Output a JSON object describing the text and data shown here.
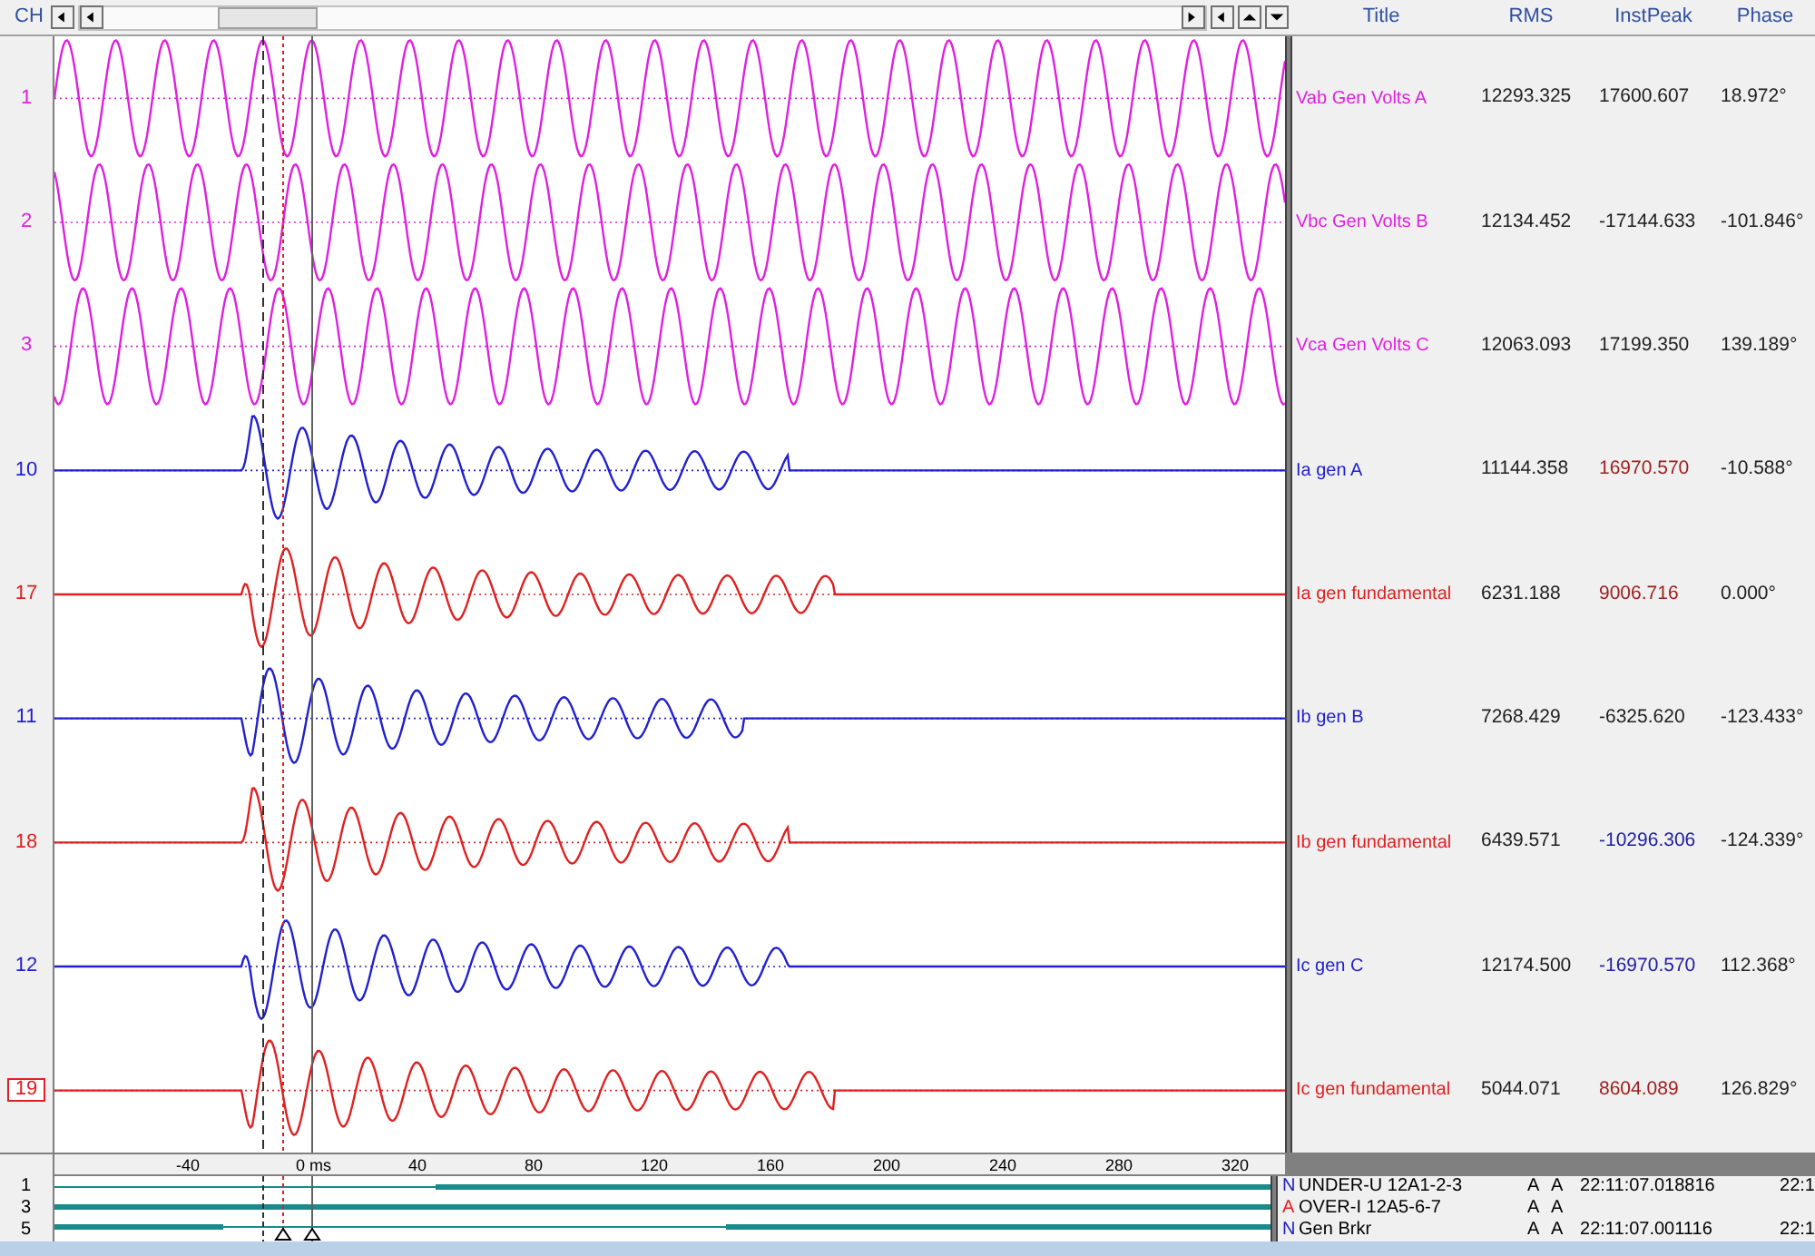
{
  "toolbar": {
    "label": "CH"
  },
  "columns": [
    "Title",
    "RMS",
    "InstPeak",
    "Phase"
  ],
  "channels": [
    {
      "number": "1",
      "title": "Vab Gen Volts A",
      "rms": "12293.325",
      "inst_peak": {
        "text": "17600.607",
        "color": "#202020"
      },
      "phase": "18.972°",
      "color": "#e020e0",
      "kind": "sine",
      "selected": false
    },
    {
      "number": "2",
      "title": "Vbc Gen Volts B",
      "rms": "12134.452",
      "inst_peak": {
        "text": "-17144.633",
        "color": "#202020"
      },
      "phase": "-101.846°",
      "color": "#e020e0",
      "kind": "sine",
      "selected": false
    },
    {
      "number": "3",
      "title": "Vca Gen Volts C",
      "rms": "12063.093",
      "inst_peak": {
        "text": "17199.350",
        "color": "#202020"
      },
      "phase": "139.189°",
      "color": "#e020e0",
      "kind": "sine",
      "selected": false
    },
    {
      "number": "10",
      "title": "Ia gen A",
      "rms": "11144.358",
      "inst_peak": {
        "text": "16970.570",
        "color": "#a02020"
      },
      "phase": "-10.588°",
      "color": "#2020d0",
      "kind": "fault",
      "selected": false
    },
    {
      "number": "17",
      "title": "Ia gen fundamental",
      "rms": "6231.188",
      "inst_peak": {
        "text": "9006.716",
        "color": "#a02020"
      },
      "phase": "0.000°",
      "color": "#e02020",
      "kind": "fault",
      "selected": false
    },
    {
      "number": "11",
      "title": "Ib gen B",
      "rms": "7268.429",
      "inst_peak": {
        "text": "-6325.620",
        "color": "#202020"
      },
      "phase": "-123.433°",
      "color": "#2020d0",
      "kind": "fault",
      "selected": false
    },
    {
      "number": "18",
      "title": "Ib gen fundamental",
      "rms": "6439.571",
      "inst_peak": {
        "text": "-10296.306",
        "color": "#2020a0"
      },
      "phase": "-124.339°",
      "color": "#e02020",
      "kind": "fault",
      "selected": false
    },
    {
      "number": "12",
      "title": "Ic gen C",
      "rms": "12174.500",
      "inst_peak": {
        "text": "-16970.570",
        "color": "#2020a0"
      },
      "phase": "112.368°",
      "color": "#2020d0",
      "kind": "fault",
      "selected": false
    },
    {
      "number": "19",
      "title": "Ic gen fundamental",
      "rms": "5044.071",
      "inst_peak": {
        "text": "8604.089",
        "color": "#a02020"
      },
      "phase": "126.829°",
      "color": "#e02020",
      "kind": "fault",
      "selected": true
    }
  ],
  "axis": {
    "ticks": [
      "-40",
      "0 ms",
      "40",
      "80",
      "120",
      "160",
      "200",
      "240",
      "280",
      "320"
    ]
  },
  "digital": [
    {
      "number": "1",
      "flag": {
        "text": "N",
        "color": "#2020c0"
      },
      "name": "UNDER-U 12A1-2-3",
      "col_1": "A",
      "col_2": "A",
      "time": "22:11:07.018816",
      "column_5": "22:1"
    },
    {
      "number": "3",
      "flag": {
        "text": "A",
        "color": "#e02020"
      },
      "name": "OVER-I 12A5-6-7",
      "col_1": "A",
      "col_2": "A"
    },
    {
      "number": "5",
      "flag": {
        "text": "N",
        "color": "#2020c0"
      },
      "name": "Gen Brkr",
      "col_1": "A",
      "col_2": "A",
      "time": "22:11:07.001116",
      "column_5": "22:1"
    }
  ]
}
